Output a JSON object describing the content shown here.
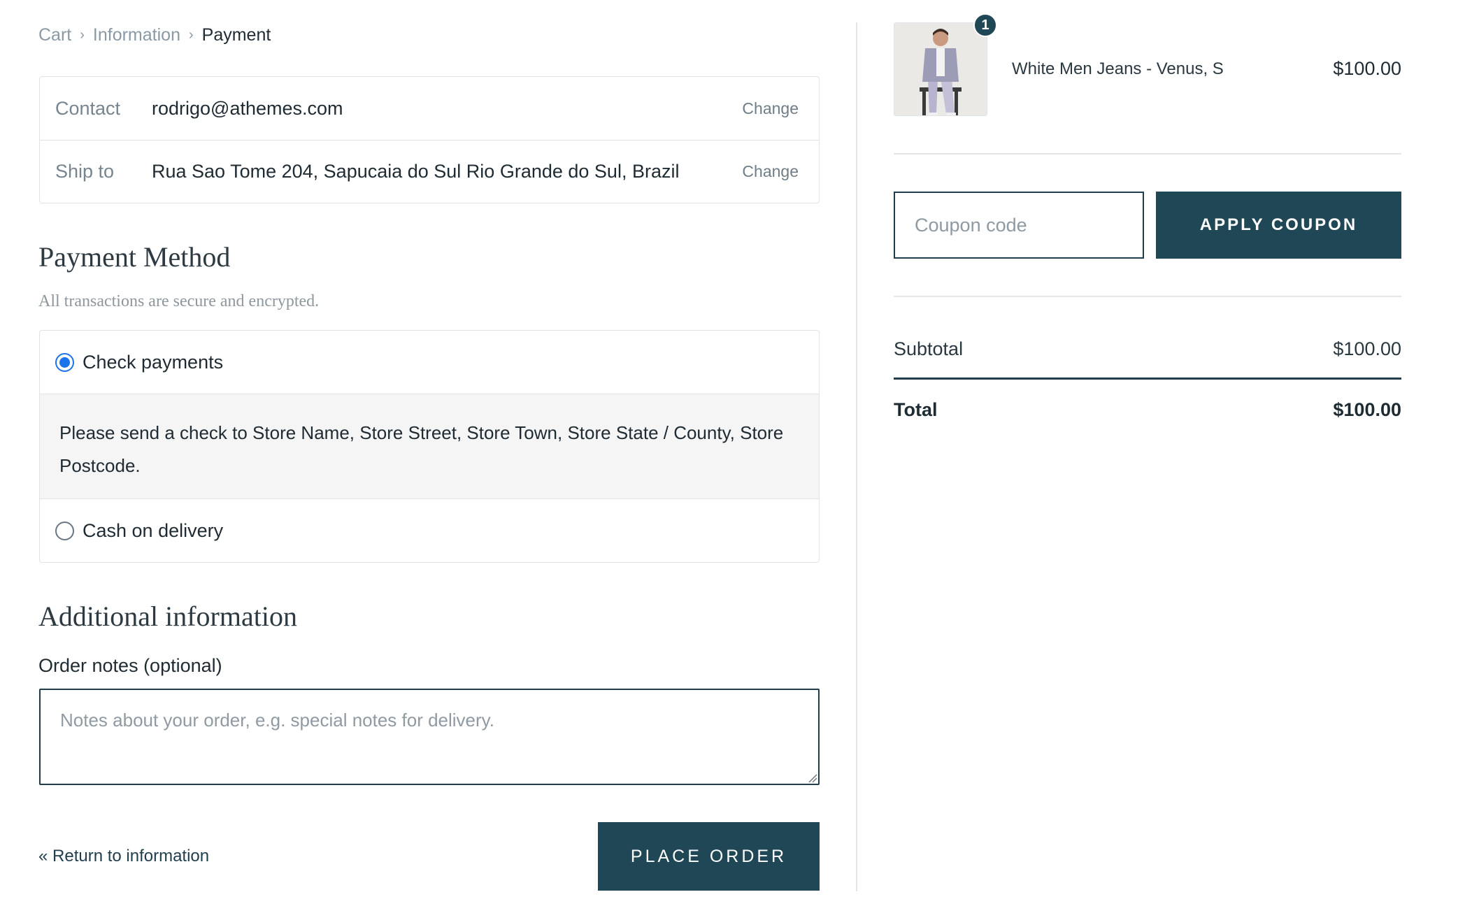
{
  "breadcrumb": {
    "items": [
      "Cart",
      "Information",
      "Payment"
    ]
  },
  "review": {
    "contact_label": "Contact",
    "contact_value": "rodrigo@athemes.com",
    "ship_label": "Ship to",
    "ship_value": "Rua Sao Tome 204, Sapucaia do Sul Rio Grande do Sul, Brazil",
    "change_label": "Change"
  },
  "payment": {
    "title": "Payment Method",
    "note": "All transactions are secure and encrypted.",
    "options": [
      {
        "label": "Check payments",
        "selected": true,
        "description": "Please send a check to Store Name, Store Street, Store Town, Store State / County, Store Postcode."
      },
      {
        "label": "Cash on delivery",
        "selected": false
      }
    ]
  },
  "additional": {
    "title": "Additional information",
    "notes_label": "Order notes (optional)",
    "notes_placeholder": "Notes about your order, e.g. special notes for delivery."
  },
  "actions": {
    "return_label": "« Return to information",
    "place_order_label": "PLACE ORDER"
  },
  "summary": {
    "product": {
      "name": "White Men Jeans - Venus, S",
      "price": "$100.00",
      "quantity": "1"
    },
    "coupon_placeholder": "Coupon code",
    "apply_coupon_label": "APPLY COUPON",
    "subtotal_label": "Subtotal",
    "subtotal_value": "$100.00",
    "total_label": "Total",
    "total_value": "$100.00"
  },
  "colors": {
    "accent": "#1f4756",
    "radio_selected": "#1a73e8",
    "muted_text": "#8a9aa5"
  }
}
